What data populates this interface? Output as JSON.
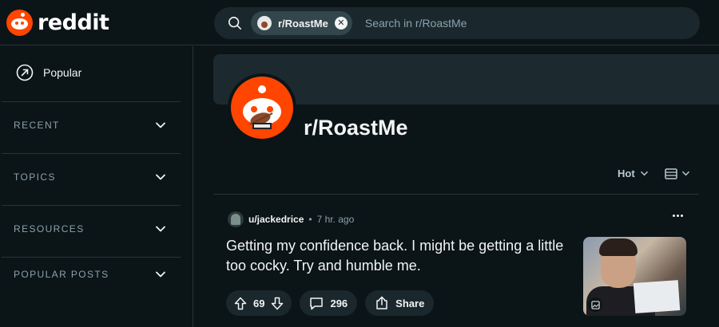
{
  "header": {
    "logo_text": "reddit",
    "search": {
      "chip_label": "r/RoastMe",
      "placeholder": "Search in r/RoastMe"
    }
  },
  "sidebar": {
    "popular_label": "Popular",
    "sections": [
      {
        "label": "RECENT"
      },
      {
        "label": "TOPICS"
      },
      {
        "label": "RESOURCES"
      },
      {
        "label": "POPULAR POSTS"
      }
    ]
  },
  "subreddit": {
    "title": "r/RoastMe",
    "sort_label": "Hot"
  },
  "post": {
    "username": "u/jackedrice",
    "separator": "•",
    "time_ago": "7 hr. ago",
    "title": "Getting my confidence back. I might be getting a little too cocky. Try and humble me.",
    "upvotes": "69",
    "comments": "296",
    "share_label": "Share"
  },
  "colors": {
    "brand": "#ff4500",
    "background": "#0b1416",
    "surface": "#1a282d",
    "muted_text": "#8ba2ad"
  }
}
